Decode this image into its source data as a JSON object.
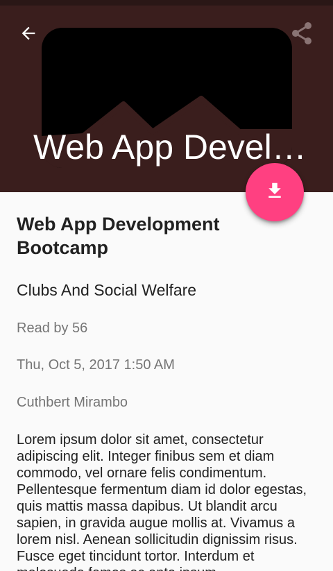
{
  "header": {
    "title": "Web App Devel…",
    "background_color": "#3a1e1d",
    "back_icon": "back-arrow-icon",
    "share_icon": "share-icon"
  },
  "fab": {
    "icon": "download-icon",
    "color": "#ff4081"
  },
  "post": {
    "title": "Web App Development Bootcamp",
    "category": "Clubs And Social Welfare",
    "read_by": "Read by 56",
    "date": "Thu, Oct 5, 2017 1:50 AM",
    "author": "Cuthbert Mirambo",
    "body": "Lorem ipsum dolor sit amet, consectetur adipiscing elit. Integer finibus sem et diam commodo, vel ornare felis condimentum. Pellentesque fermentum diam id dolor egestas, quis mattis massa dapibus. Ut blandit arcu sapien, in gravida augue mollis at. Vivamus a lorem nisl. Aenean sollicitudin dignissim risus. Fusce eget tincidunt tortor. Interdum et malesuada fames ac ante ipsum"
  }
}
